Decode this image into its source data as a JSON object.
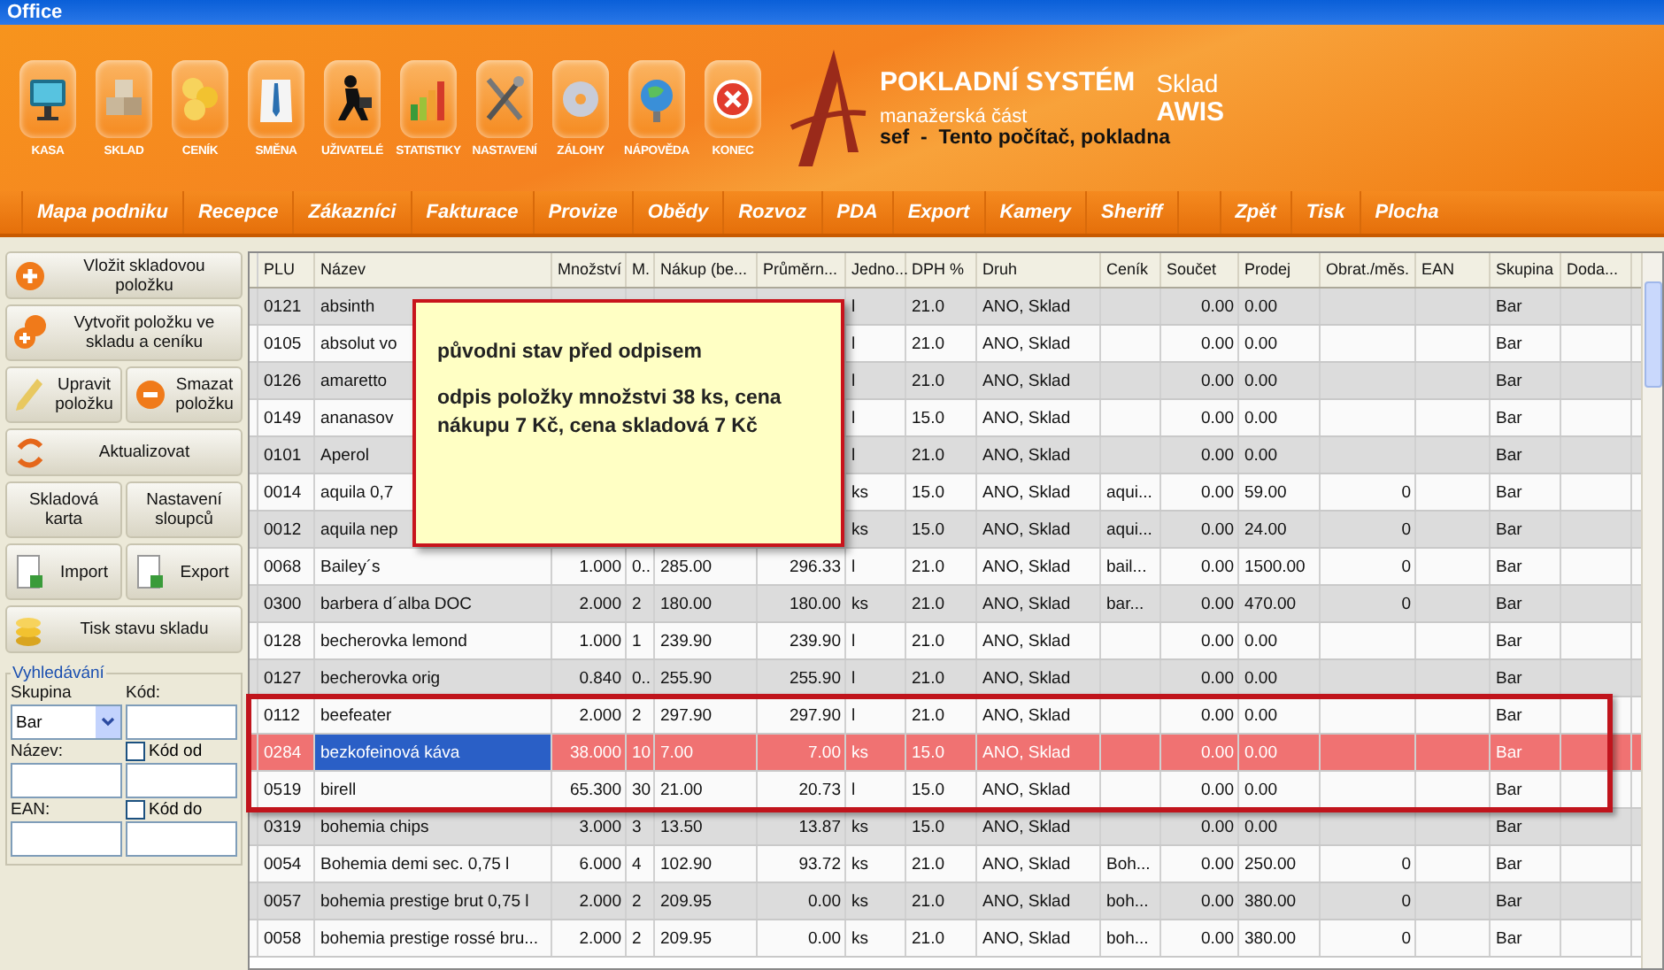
{
  "window": {
    "title": "Office"
  },
  "toolbar": [
    {
      "label": "KASA"
    },
    {
      "label": "SKLAD"
    },
    {
      "label": "CENÍK"
    },
    {
      "label": "SMĚNA"
    },
    {
      "label": "UŽIVATELÉ"
    },
    {
      "label": "STATISTIKY"
    },
    {
      "label": "NASTAVENÍ"
    },
    {
      "label": "ZÁLOHY"
    },
    {
      "label": "NÁPOVĚDA"
    },
    {
      "label": "KONEC"
    }
  ],
  "brand": {
    "title": "POKLADNÍ SYSTÉM",
    "module": "Sklad",
    "subtitle": "manažerská část",
    "product": "AWIS",
    "user_line": "sef  -  Tento počítač, pokladna"
  },
  "nav": [
    {
      "kind": "link",
      "label": "Mapa podniku"
    },
    {
      "kind": "link",
      "label": "Recepce"
    },
    {
      "kind": "link",
      "label": "Zákazníci"
    },
    {
      "kind": "link",
      "label": "Fakturace"
    },
    {
      "kind": "link",
      "label": "Provize"
    },
    {
      "kind": "link",
      "label": "Obědy"
    },
    {
      "kind": "link",
      "label": "Rozvoz"
    },
    {
      "kind": "link",
      "label": "PDA"
    },
    {
      "kind": "link",
      "label": "Export"
    },
    {
      "kind": "link",
      "label": "Kamery"
    },
    {
      "kind": "link",
      "label": "Sheriff"
    },
    {
      "kind": "spacer"
    },
    {
      "kind": "link",
      "label": "Zpět"
    },
    {
      "kind": "link",
      "label": "Tisk"
    },
    {
      "kind": "link",
      "label": "Plocha"
    }
  ],
  "actions": [
    [
      {
        "label": "Vložit skladovou položku"
      }
    ],
    [
      {
        "label": "Vytvořit položku ve skladu a ceníku"
      }
    ],
    [
      {
        "label": "Upravit položku"
      },
      {
        "label": "Smazat položku"
      }
    ],
    [
      {
        "label": "Aktualizovat"
      }
    ],
    [
      {
        "label": "Skladová karta"
      },
      {
        "label": "Nastavení sloupců"
      }
    ],
    [
      {
        "label": "Import"
      },
      {
        "label": "Export"
      }
    ],
    [
      {
        "label": "Tisk stavu skladu"
      }
    ]
  ],
  "search": {
    "title": "Vyhledávání",
    "group_label": "Skupina",
    "group_value": "Bar",
    "code_label": "Kód:",
    "name_label": "Název:",
    "code_from": {
      "label": "Kód od",
      "checked": false
    },
    "ean_label": "EAN:",
    "code_to": {
      "label": "Kód do",
      "checked": false
    }
  },
  "table": {
    "columns": [
      "PLU",
      "Název",
      "Množství",
      "M.",
      "Nákup (be...",
      "Průměrn...",
      "Jedno...",
      "DPH %",
      "Druh",
      "Ceník",
      "Součet",
      "Prodej",
      "Obrat./měs.",
      "EAN",
      "Skupina",
      "Doda..."
    ],
    "rows": [
      {
        "selected": false,
        "framed": false,
        "cells": [
          "0121",
          "absinth",
          null,
          null,
          null,
          null,
          "l",
          "21.0",
          "ANO, Sklad",
          null,
          "0.00",
          "0.00",
          null,
          null,
          "Bar",
          null
        ]
      },
      {
        "selected": false,
        "framed": false,
        "cells": [
          "0105",
          "absolut vo",
          null,
          null,
          null,
          null,
          "l",
          "21.0",
          "ANO, Sklad",
          null,
          "0.00",
          "0.00",
          null,
          null,
          "Bar",
          null
        ]
      },
      {
        "selected": false,
        "framed": false,
        "cells": [
          "0126",
          "amaretto",
          null,
          null,
          null,
          null,
          "l",
          "21.0",
          "ANO, Sklad",
          null,
          "0.00",
          "0.00",
          null,
          null,
          "Bar",
          null
        ]
      },
      {
        "selected": false,
        "framed": false,
        "cells": [
          "0149",
          "ananasov",
          null,
          null,
          null,
          null,
          "l",
          "15.0",
          "ANO, Sklad",
          null,
          "0.00",
          "0.00",
          null,
          null,
          "Bar",
          null
        ]
      },
      {
        "selected": false,
        "framed": false,
        "cells": [
          "0101",
          "Aperol",
          null,
          null,
          null,
          null,
          "l",
          "21.0",
          "ANO, Sklad",
          null,
          "0.00",
          "0.00",
          null,
          null,
          "Bar",
          null
        ]
      },
      {
        "selected": false,
        "framed": false,
        "cells": [
          "0014",
          "aquila 0,7",
          null,
          null,
          null,
          null,
          "ks",
          "15.0",
          "ANO, Sklad",
          "aqui...",
          "0.00",
          "59.00",
          "0",
          null,
          "Bar",
          null
        ]
      },
      {
        "selected": false,
        "framed": false,
        "cells": [
          "0012",
          "aquila nep",
          null,
          null,
          null,
          null,
          "ks",
          "15.0",
          "ANO, Sklad",
          "aqui...",
          "0.00",
          "24.00",
          "0",
          null,
          "Bar",
          null
        ]
      },
      {
        "selected": false,
        "framed": false,
        "cells": [
          "0068",
          "Bailey´s",
          "1.000",
          "0..",
          "285.00",
          "296.33",
          "l",
          "21.0",
          "ANO, Sklad",
          "bail...",
          "0.00",
          "1500.00",
          "0",
          null,
          "Bar",
          null
        ]
      },
      {
        "selected": false,
        "framed": false,
        "cells": [
          "0300",
          "barbera d´alba DOC",
          "2.000",
          "2",
          "180.00",
          "180.00",
          "ks",
          "21.0",
          "ANO, Sklad",
          "bar...",
          "0.00",
          "470.00",
          "0",
          null,
          "Bar",
          null
        ]
      },
      {
        "selected": false,
        "framed": false,
        "cells": [
          "0128",
          "becherovka lemond",
          "1.000",
          "1",
          "239.90",
          "239.90",
          "l",
          "21.0",
          "ANO, Sklad",
          null,
          "0.00",
          "0.00",
          null,
          null,
          "Bar",
          null
        ]
      },
      {
        "selected": false,
        "framed": false,
        "cells": [
          "0127",
          "becherovka orig",
          "0.840",
          "0..",
          "255.90",
          "255.90",
          "l",
          "21.0",
          "ANO, Sklad",
          null,
          "0.00",
          "0.00",
          null,
          null,
          "Bar",
          null
        ]
      },
      {
        "selected": false,
        "framed": true,
        "cells": [
          "0112",
          "beefeater",
          "2.000",
          "2",
          "297.90",
          "297.90",
          "l",
          "21.0",
          "ANO, Sklad",
          null,
          "0.00",
          "0.00",
          null,
          null,
          "Bar",
          null
        ]
      },
      {
        "selected": true,
        "framed": true,
        "cells": [
          "0284",
          "bezkofeinová káva",
          "38.000",
          "10",
          "7.00",
          "7.00",
          "ks",
          "15.0",
          "ANO, Sklad",
          null,
          "0.00",
          "0.00",
          null,
          null,
          "Bar",
          null
        ]
      },
      {
        "selected": false,
        "framed": true,
        "cells": [
          "0519",
          "birell",
          "65.300",
          "30",
          "21.00",
          "20.73",
          "l",
          "15.0",
          "ANO, Sklad",
          null,
          "0.00",
          "0.00",
          null,
          null,
          "Bar",
          null
        ]
      },
      {
        "selected": false,
        "framed": false,
        "cells": [
          "0319",
          "bohemia chips",
          "3.000",
          "3",
          "13.50",
          "13.87",
          "ks",
          "15.0",
          "ANO, Sklad",
          null,
          "0.00",
          "0.00",
          null,
          null,
          "Bar",
          null
        ]
      },
      {
        "selected": false,
        "framed": false,
        "cells": [
          "0054",
          "Bohemia demi sec. 0,75 l",
          "6.000",
          "4",
          "102.90",
          "93.72",
          "ks",
          "21.0",
          "ANO, Sklad",
          "Boh...",
          "0.00",
          "250.00",
          "0",
          null,
          "Bar",
          null
        ]
      },
      {
        "selected": false,
        "framed": false,
        "cells": [
          "0057",
          "bohemia prestige brut 0,75 l",
          "2.000",
          "2",
          "209.95",
          "0.00",
          "ks",
          "21.0",
          "ANO, Sklad",
          "boh...",
          "0.00",
          "380.00",
          "0",
          null,
          "Bar",
          null
        ]
      },
      {
        "selected": false,
        "framed": false,
        "cells": [
          "0058",
          "bohemia prestige rossé bru...",
          "2.000",
          "2",
          "209.95",
          "0.00",
          "ks",
          "21.0",
          "ANO, Sklad",
          "boh...",
          "0.00",
          "380.00",
          "0",
          null,
          "Bar",
          null
        ]
      }
    ]
  },
  "callout": {
    "heading": "původni stav před odpisem",
    "text": "odpis položky množstvi 38 ks, cena nákupu 7 Kč, cena skladová 7 Kč"
  }
}
